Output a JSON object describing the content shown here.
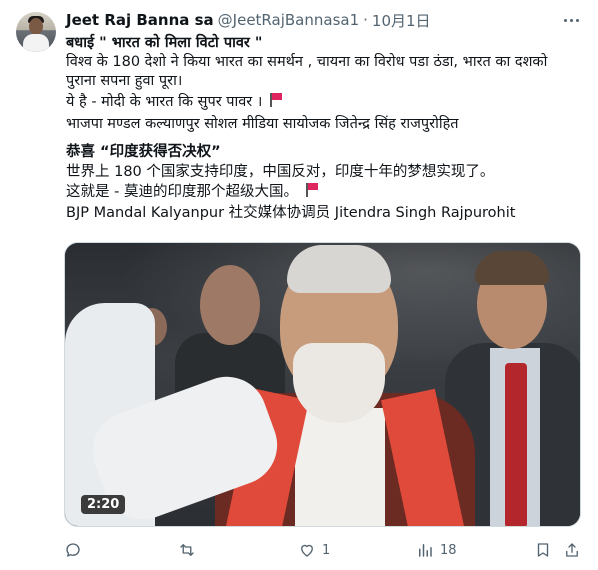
{
  "tweet": {
    "author": {
      "display_name": "Jeet Raj Banna sa",
      "handle": "@JeetRajBannasa1",
      "separator": "·",
      "date": "10月1日"
    },
    "hindi": {
      "line1_prefix": "बधाई ",
      "line1_quote": " \" भारत को मिला विटो पावर \"",
      "line2": "विश्व के 180 देशो ने किया भारत का समर्थन , चायना का विरोध पडा ठंडा, भारत का दशको",
      "line3": "पुराना सपना हुवा पूरा।",
      "line4": "ये है - मोदी के भारत कि सुपर पावर ।",
      "line5": "भाजपा मण्डल कल्याणपुर सोशल मीडिया सायोजक जितेन्द्र सिंह राजपुरोहित"
    },
    "chinese": {
      "line1": "恭喜 “印度获得否决权”",
      "line2": "世界上 180 个国家支持印度，中国反对，印度十年的梦想实现了。",
      "line3": "这就是 - 莫迪的印度那个超级大国。",
      "line4": "BJP Mandal Kalyanpur 社交媒体协调员 Jitendra Singh Rajpurohit"
    },
    "video": {
      "duration": "2:20"
    },
    "actions": {
      "reply_count": "",
      "retweet_count": "",
      "like_count": "1",
      "views_count": "18"
    }
  },
  "icons": {
    "menu": "more-icon",
    "reply": "reply-icon",
    "retweet": "retweet-icon",
    "like": "heart-icon",
    "views": "views-icon",
    "bookmark": "bookmark-icon",
    "share": "share-icon",
    "flag": "red-flag-icon"
  },
  "colors": {
    "text_primary": "#0f1419",
    "text_secondary": "#536471",
    "flag_red": "#e0245e"
  }
}
